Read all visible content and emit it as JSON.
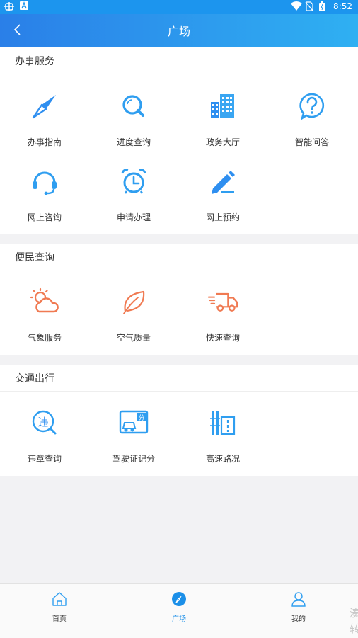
{
  "status_bar": {
    "time": "8:52"
  },
  "app_bar": {
    "title": "广场"
  },
  "sections": [
    {
      "title": "办事服务",
      "items": [
        {
          "label": "办事指南"
        },
        {
          "label": "进度查询"
        },
        {
          "label": "政务大厅"
        },
        {
          "label": "智能问答"
        },
        {
          "label": "网上咨询"
        },
        {
          "label": "申请办理"
        },
        {
          "label": "网上预约"
        }
      ]
    },
    {
      "title": "便民查询",
      "items": [
        {
          "label": "气象服务"
        },
        {
          "label": "空气质量"
        },
        {
          "label": "快速查询"
        }
      ]
    },
    {
      "title": "交通出行",
      "items": [
        {
          "label": "违章查询"
        },
        {
          "label": "驾驶证记分"
        },
        {
          "label": "高速路况"
        }
      ]
    }
  ],
  "tabs": [
    {
      "label": "首页"
    },
    {
      "label": "广场"
    },
    {
      "label": "我的"
    }
  ],
  "watermark": "湊转",
  "colors": {
    "accent_blue": "#1b8fe8",
    "orange": "#f07a52"
  }
}
